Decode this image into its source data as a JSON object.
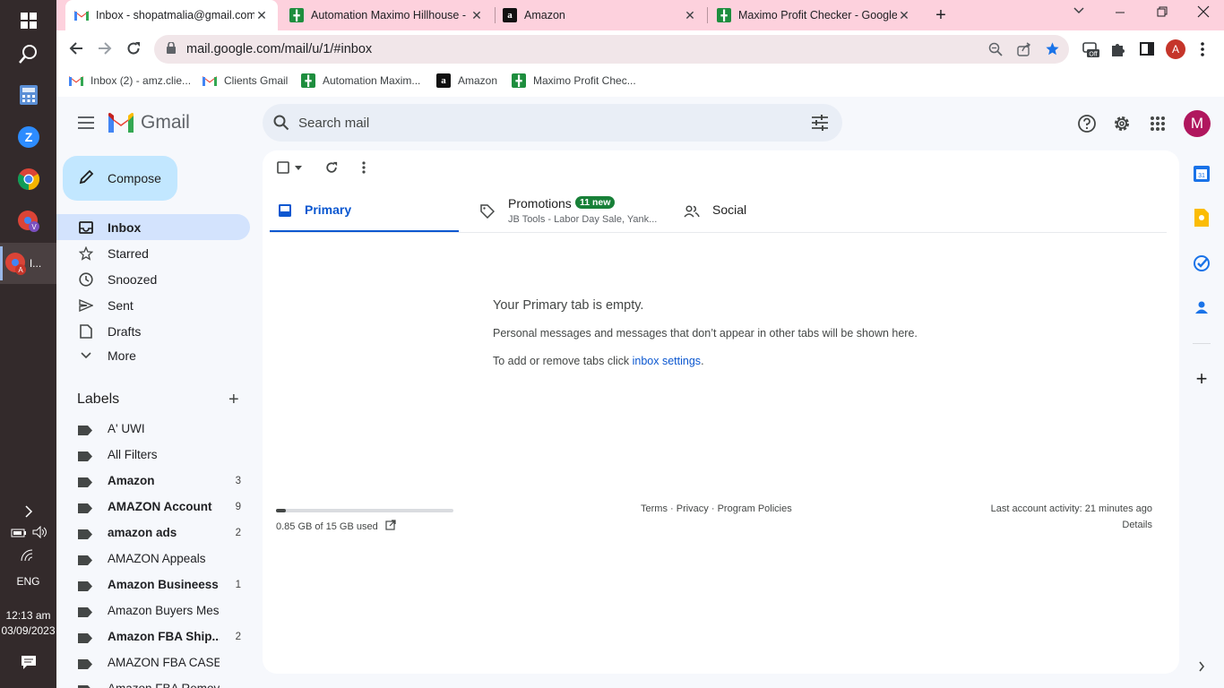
{
  "taskbar": {
    "lang": "ENG",
    "time": "12:13 am",
    "date": "03/09/2023",
    "chrome_active_label": "I..."
  },
  "browser": {
    "tabs": [
      {
        "title": "Inbox - shopatmalia@gmail.com",
        "favicon": "gmail-icon",
        "active": true
      },
      {
        "title": "Automation Maximo Hillhouse -",
        "favicon": "sheets-icon",
        "active": false
      },
      {
        "title": "Amazon",
        "favicon": "amazon-icon",
        "active": false
      },
      {
        "title": "Maximo Profit Checker - Google",
        "favicon": "sheets-icon",
        "active": false
      }
    ],
    "url": "mail.google.com/mail/u/1/#inbox",
    "profile_initial": "A",
    "bookmarks": [
      {
        "label": "Inbox (2) - amz.clie...",
        "favicon": "gmail-icon"
      },
      {
        "label": "Clients Gmail",
        "favicon": "gmail-icon"
      },
      {
        "label": "Automation Maxim...",
        "favicon": "sheets-icon"
      },
      {
        "label": "Amazon",
        "favicon": "amazon-icon"
      },
      {
        "label": "Maximo Profit Chec...",
        "favicon": "sheets-icon"
      }
    ]
  },
  "gmail": {
    "logo_text": "Gmail",
    "search_placeholder": "Search mail",
    "avatar_initial": "M",
    "compose_label": "Compose",
    "nav": [
      {
        "label": "Inbox",
        "icon": "inbox-icon",
        "active": true
      },
      {
        "label": "Starred",
        "icon": "star-icon",
        "active": false
      },
      {
        "label": "Snoozed",
        "icon": "clock-icon",
        "active": false
      },
      {
        "label": "Sent",
        "icon": "send-icon",
        "active": false
      },
      {
        "label": "Drafts",
        "icon": "draft-icon",
        "active": false
      },
      {
        "label": "More",
        "icon": "chevron-down-icon",
        "active": false
      }
    ],
    "labels_heading": "Labels",
    "labels": [
      {
        "name": "A' UWI",
        "count": "",
        "bold": false
      },
      {
        "name": "All Filters",
        "count": "",
        "bold": false
      },
      {
        "name": "Amazon",
        "count": "3",
        "bold": true
      },
      {
        "name": "AMAZON Account",
        "count": "9",
        "bold": true
      },
      {
        "name": "amazon ads",
        "count": "2",
        "bold": true
      },
      {
        "name": "AMAZON Appeals",
        "count": "",
        "bold": false
      },
      {
        "name": "Amazon Busineess",
        "count": "1",
        "bold": true
      },
      {
        "name": "Amazon Buyers Message",
        "count": "",
        "bold": false
      },
      {
        "name": "Amazon FBA Ship...",
        "count": "2",
        "bold": true
      },
      {
        "name": "AMAZON FBA CASE LOG",
        "count": "",
        "bold": false
      },
      {
        "name": "Amazon FBA Removal",
        "count": "",
        "bold": false
      }
    ],
    "tabs": {
      "primary": "Primary",
      "promotions": "Promotions",
      "promotions_badge": "11 new",
      "promotions_snippet": "JB Tools - Labor Day Sale, Yank...",
      "social": "Social"
    },
    "empty": {
      "title": "Your Primary tab is empty.",
      "line1": "Personal messages and messages that don’t appear in other tabs will be shown here.",
      "line2_prefix": "To add or remove tabs click ",
      "line2_link": "inbox settings",
      "line2_suffix": "."
    },
    "storage": {
      "text": "0.85 GB of 15 GB used",
      "fraction": 0.057
    },
    "footer": {
      "terms": "Terms",
      "privacy": "Privacy",
      "policies": "Program Policies",
      "sep": " · ",
      "activity": "Last account activity: 21 minutes ago",
      "details": "Details"
    }
  },
  "colors": {
    "chrome_frame": "#fdd1dd",
    "accent": "#0b57d0",
    "inbox_active": "#d3e3fd",
    "compose": "#c2e7ff",
    "badge": "#188038",
    "avatar": "#b0175e"
  }
}
